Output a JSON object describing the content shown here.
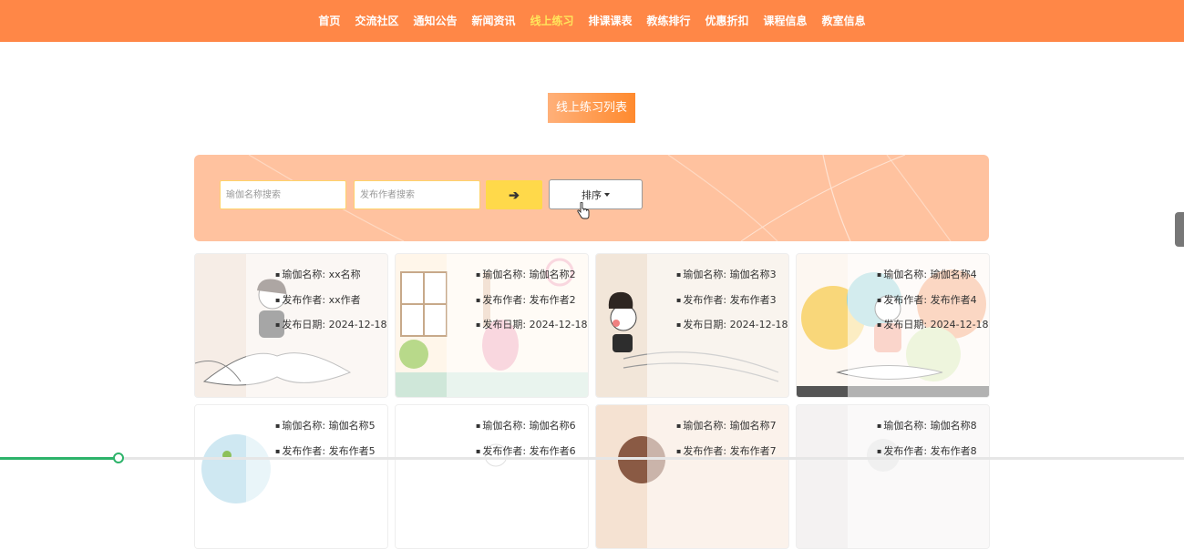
{
  "nav": {
    "items": [
      "首页",
      "交流社区",
      "通知公告",
      "新闻资讯",
      "线上练习",
      "排课课表",
      "教练排行",
      "优惠折扣",
      "课程信息",
      "教室信息"
    ],
    "active_index": 4,
    "active_color": "#ffe65c",
    "bar_color": "#ff8747"
  },
  "page": {
    "title": "线上练习列表"
  },
  "search": {
    "name_placeholder": "瑜伽名称搜索",
    "author_placeholder": "发布作者搜索",
    "submit_icon": "arrow-right-icon",
    "sort_label": "排序"
  },
  "cards": [
    {
      "name_label": "瑜伽名称: xx名称",
      "author_label": "发布作者: xx作者",
      "date_label": "发布日期: 2024-12-18"
    },
    {
      "name_label": "瑜伽名称: 瑜伽名称2",
      "author_label": "发布作者: 发布作者2",
      "date_label": "发布日期: 2024-12-18"
    },
    {
      "name_label": "瑜伽名称: 瑜伽名称3",
      "author_label": "发布作者: 发布作者3",
      "date_label": "发布日期: 2024-12-18"
    },
    {
      "name_label": "瑜伽名称: 瑜伽名称4",
      "author_label": "发布作者: 发布作者4",
      "date_label": "发布日期: 2024-12-18"
    },
    {
      "name_label": "瑜伽名称: 瑜伽名称5",
      "author_label": "发布作者: 发布作者5"
    },
    {
      "name_label": "瑜伽名称: 瑜伽名称6",
      "author_label": "发布作者: 发布作者6"
    },
    {
      "name_label": "瑜伽名称: 瑜伽名称7",
      "author_label": "发布作者: 发布作者7"
    },
    {
      "name_label": "瑜伽名称: 瑜伽名称8",
      "author_label": "发布作者: 发布作者8"
    }
  ],
  "progress": {
    "fraction": 0.1
  }
}
